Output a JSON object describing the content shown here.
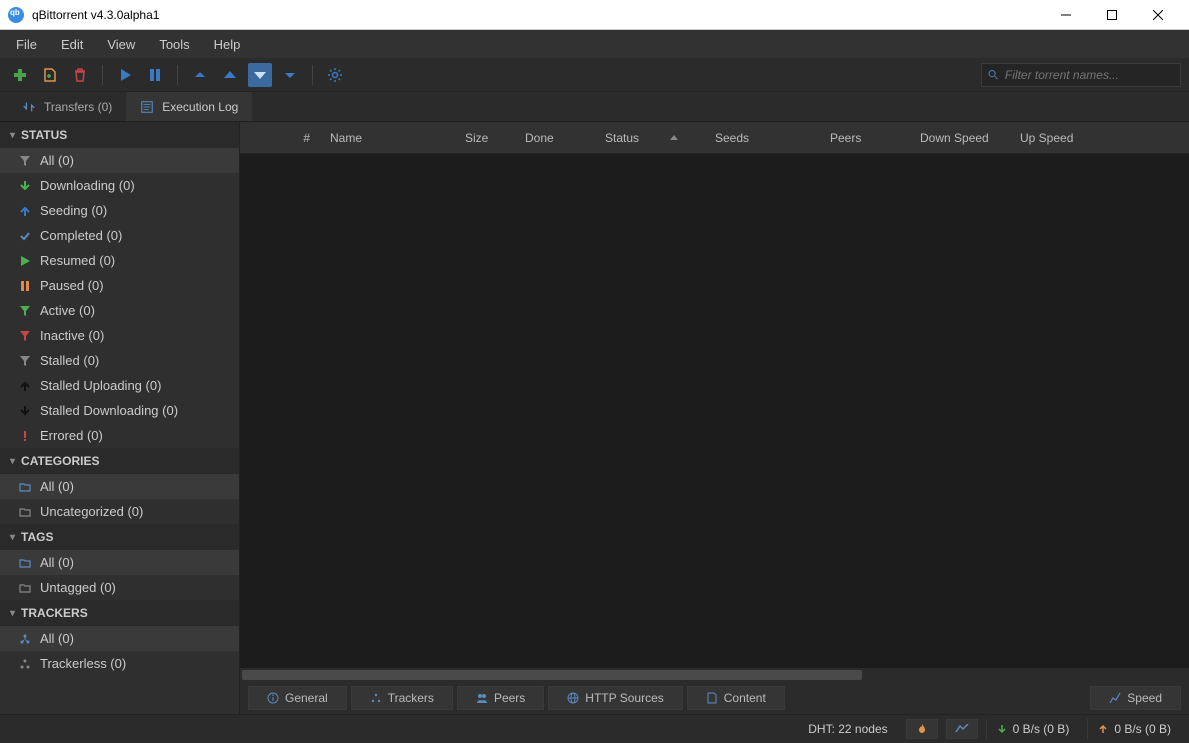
{
  "title": "qBittorrent v4.3.0alpha1",
  "menu": [
    "File",
    "Edit",
    "View",
    "Tools",
    "Help"
  ],
  "search_placeholder": "Filter torrent names...",
  "tabs": {
    "transfers": "Transfers (0)",
    "execlog": "Execution Log"
  },
  "sidebar": {
    "status_header": "STATUS",
    "status": [
      {
        "label": "All (0)",
        "icon": "filter-gray"
      },
      {
        "label": "Downloading (0)",
        "icon": "arrow-down-green"
      },
      {
        "label": "Seeding (0)",
        "icon": "arrow-up-blue"
      },
      {
        "label": "Completed (0)",
        "icon": "check-blue"
      },
      {
        "label": "Resumed (0)",
        "icon": "play-green"
      },
      {
        "label": "Paused (0)",
        "icon": "pause-orange"
      },
      {
        "label": "Active (0)",
        "icon": "filter-green"
      },
      {
        "label": "Inactive (0)",
        "icon": "filter-red"
      },
      {
        "label": "Stalled (0)",
        "icon": "filter-gray"
      },
      {
        "label": "Stalled Uploading (0)",
        "icon": "arrow-up-black"
      },
      {
        "label": "Stalled Downloading (0)",
        "icon": "arrow-down-black"
      },
      {
        "label": "Errored (0)",
        "icon": "error-red"
      }
    ],
    "categories_header": "CATEGORIES",
    "categories": [
      {
        "label": "All (0)"
      },
      {
        "label": "Uncategorized (0)"
      }
    ],
    "tags_header": "TAGS",
    "tags": [
      {
        "label": "All (0)"
      },
      {
        "label": "Untagged (0)"
      }
    ],
    "trackers_header": "TRACKERS",
    "trackers": [
      {
        "label": "All (0)"
      },
      {
        "label": "Trackerless (0)"
      }
    ]
  },
  "columns": [
    "#",
    "Name",
    "Size",
    "Done",
    "Status",
    "Seeds",
    "Peers",
    "Down Speed",
    "Up Speed"
  ],
  "bottom_tabs": [
    "General",
    "Trackers",
    "Peers",
    "HTTP Sources",
    "Content",
    "Speed"
  ],
  "status": {
    "dht": "DHT: 22 nodes",
    "down": "0 B/s (0 B)",
    "up": "0 B/s (0 B)"
  }
}
